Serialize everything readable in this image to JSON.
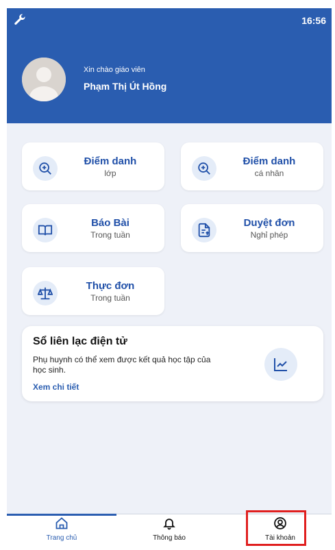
{
  "status_bar": {
    "time": "16:56"
  },
  "header": {
    "greeting": "Xin chào giáo viên",
    "name": "Phạm Thị Út Hồng"
  },
  "menu": [
    {
      "title": "Điểm danh",
      "subtitle": "lớp",
      "icon": "zoom-plus-icon"
    },
    {
      "title": "Điểm danh",
      "subtitle": "cá nhân",
      "icon": "zoom-plus-icon"
    },
    {
      "title": "Báo Bài",
      "subtitle": "Trong tuần",
      "icon": "book-icon"
    },
    {
      "title": "Duyệt đơn",
      "subtitle": "Nghỉ phép",
      "icon": "document-upload-icon"
    },
    {
      "title": "Thực đơn",
      "subtitle": "Trong tuần",
      "icon": "scale-icon"
    }
  ],
  "contact_book": {
    "title": "Sổ liên lạc điện tử",
    "description": "Phụ huynh có thể xem được kết quả học tập của học sinh.",
    "link": "Xem chi tiết",
    "icon": "line-chart-icon"
  },
  "bottom_nav": [
    {
      "label": "Trang chủ",
      "icon": "home-icon",
      "active": true
    },
    {
      "label": "Thông báo",
      "icon": "bell-icon",
      "active": false
    },
    {
      "label": "Tài khoản",
      "icon": "account-icon",
      "active": false
    }
  ],
  "colors": {
    "primary": "#2a5db0",
    "background": "#eef1f8",
    "icon_circle": "#e4ecf8",
    "highlight": "#e01e1e"
  }
}
